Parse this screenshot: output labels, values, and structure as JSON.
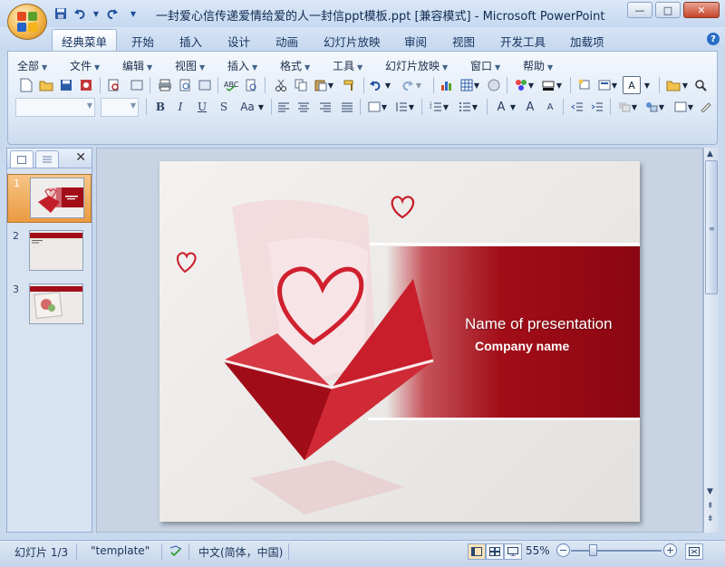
{
  "window": {
    "title": "一封爱心信传递爱情给爱的人一封信ppt模板.ppt [兼容模式] - Microsoft PowerPoint",
    "minimize": "—",
    "maximize": "□",
    "close": "✕"
  },
  "quick_access": {
    "save_icon": "save-icon",
    "undo_icon": "undo-icon",
    "redo_icon": "redo-icon"
  },
  "tabs": [
    {
      "label": "经典菜单",
      "active": true
    },
    {
      "label": "开始"
    },
    {
      "label": "插入"
    },
    {
      "label": "设计"
    },
    {
      "label": "动画"
    },
    {
      "label": "幻灯片放映"
    },
    {
      "label": "审阅"
    },
    {
      "label": "视图"
    },
    {
      "label": "开发工具"
    },
    {
      "label": "加载项"
    }
  ],
  "menu": [
    {
      "label": "全部"
    },
    {
      "label": "文件"
    },
    {
      "label": "编辑"
    },
    {
      "label": "视图"
    },
    {
      "label": "插入"
    },
    {
      "label": "格式"
    },
    {
      "label": "工具"
    },
    {
      "label": "幻灯片放映"
    },
    {
      "label": "窗口"
    },
    {
      "label": "帮助"
    }
  ],
  "format_buttons": {
    "bold": "B",
    "italic": "I",
    "underline": "U",
    "shadow": "S",
    "case": "Aa"
  },
  "slides_pane": {
    "slides": [
      {
        "number": "1",
        "selected": true
      },
      {
        "number": "2"
      },
      {
        "number": "3"
      }
    ]
  },
  "slide": {
    "title": "Name of presentation",
    "subtitle": "Company name"
  },
  "status": {
    "slide_info": "幻灯片 1/3",
    "theme": "\"template\"",
    "language": "中文(简体，中国)",
    "zoom": "55%",
    "zoom_fraction": 0.55
  },
  "colors": {
    "accent_red": "#a20d18",
    "ribbon_blue": "#c9d9ee",
    "selected_orange": "#eb9a41"
  }
}
